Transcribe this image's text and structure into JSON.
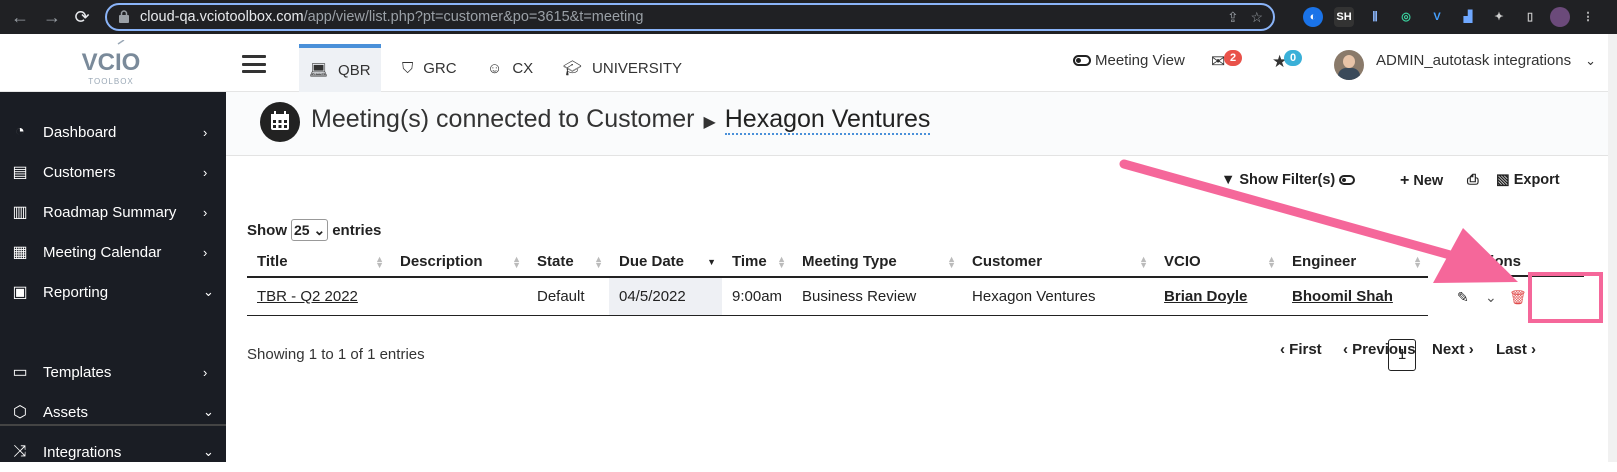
{
  "browser": {
    "url_host": "cloud-qa.vciotoolbox.com",
    "url_path": "/app/view/list.php?pt=customer&po=3615&t=meeting",
    "ext_sh": "SH"
  },
  "logo": {
    "text": "VCIO",
    "subtext": "TOOLBOX"
  },
  "top_tabs": [
    {
      "label": "QBR",
      "icon": "laptop-icon"
    },
    {
      "label": "GRC",
      "icon": "shield-icon"
    },
    {
      "label": "CX",
      "icon": "smile-icon"
    },
    {
      "label": "UNIVERSITY",
      "icon": "graduation-cap-icon"
    }
  ],
  "top_right": {
    "meeting_view": "Meeting View",
    "mail_count": "2",
    "star_count": "0",
    "user_name": "ADMIN_autotask integrations"
  },
  "sidebar": {
    "items": [
      {
        "label": "Dashboard",
        "icon": "dashboard-icon",
        "chevron": "›"
      },
      {
        "label": "Customers",
        "icon": "id-card-icon",
        "chevron": "›"
      },
      {
        "label": "Roadmap Summary",
        "icon": "map-icon",
        "chevron": "›"
      },
      {
        "label": "Meeting Calendar",
        "icon": "calendar-icon",
        "chevron": "›"
      },
      {
        "label": "Reporting",
        "icon": "report-icon",
        "chevron": "⌄"
      },
      {
        "label": "Templates",
        "icon": "templates-icon",
        "chevron": "›"
      },
      {
        "label": "Assets",
        "icon": "assets-icon",
        "chevron": "⌄"
      },
      {
        "label": "Integrations",
        "icon": "shuffle-icon",
        "chevron": "⌄"
      }
    ]
  },
  "page": {
    "title_prefix": "Meeting(s) connected to Customer",
    "customer": "Hexagon Ventures"
  },
  "toolbar": {
    "show_filters": "Show Filter(s)",
    "new": "New",
    "export": "Export"
  },
  "entries": {
    "show": "Show",
    "value": "25",
    "suffix": "entries"
  },
  "table": {
    "columns": [
      "Title",
      "Description",
      "State",
      "Due Date",
      "Time",
      "Meeting Type",
      "Customer",
      "VCIO",
      "Engineer"
    ],
    "actions_header": "Actions",
    "rows": [
      {
        "title": "TBR - Q2 2022",
        "description": "",
        "state": "Default",
        "due_date": "04/5/2022",
        "time": "9:00am",
        "meeting_type": "Business Review",
        "customer": "Hexagon Ventures",
        "vcio": "Brian Doyle",
        "engineer": "Bhoomil Shah"
      }
    ]
  },
  "footer": {
    "showing": "Showing 1 to 1 of 1 entries",
    "first": "First",
    "previous": "Previous",
    "page": "1",
    "next": "Next",
    "last": "Last"
  },
  "colors": {
    "accent": "#4a90d9",
    "sidebar_bg": "#1a1d24",
    "annotation": "#f5679a",
    "delete": "#e04b4b",
    "mail_badge": "#e9524a",
    "star_badge": "#3ab0d8"
  }
}
